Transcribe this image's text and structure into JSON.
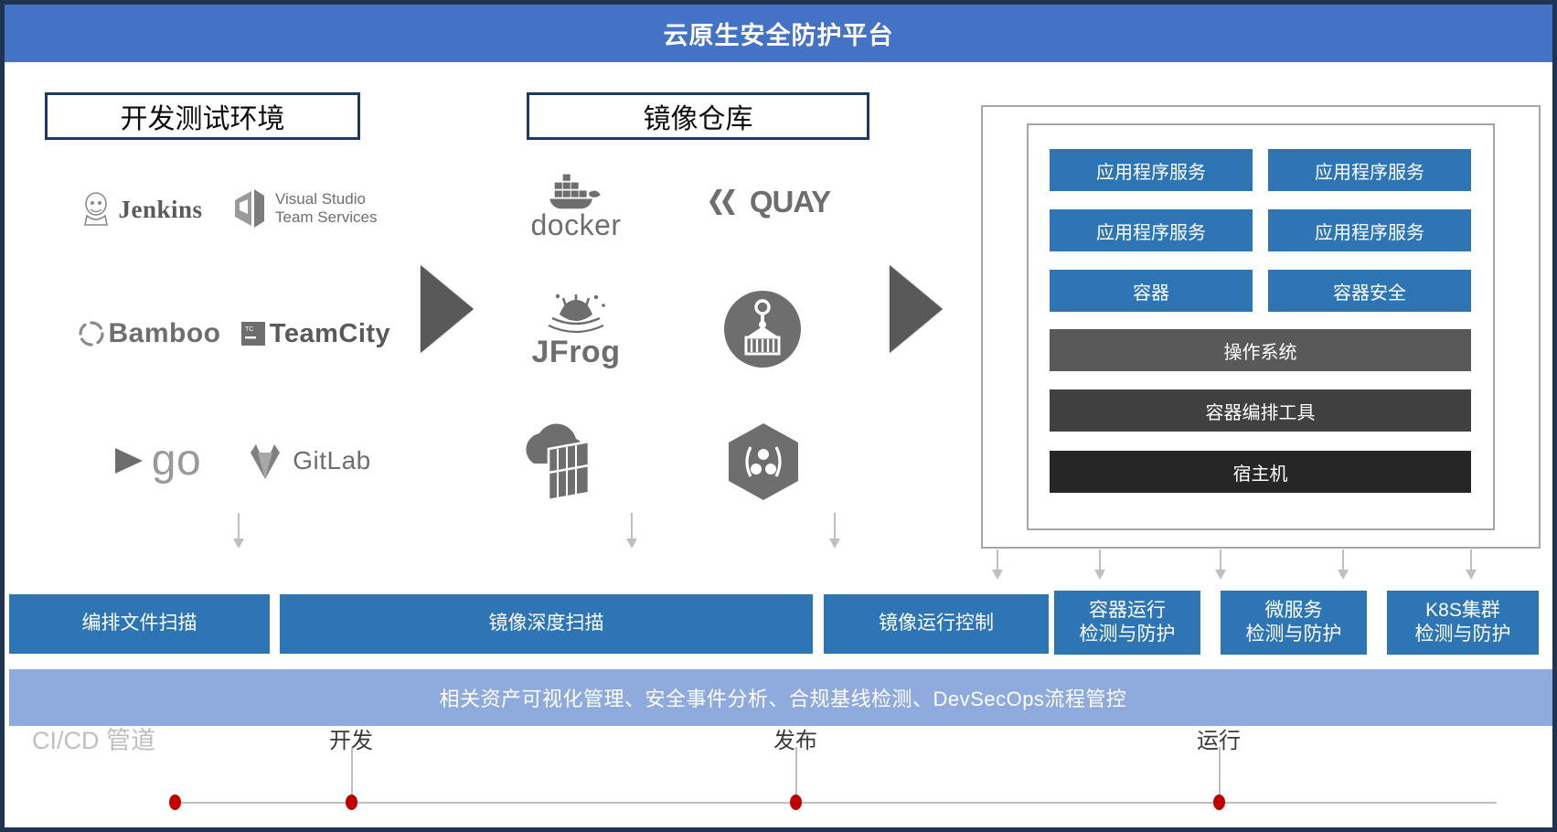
{
  "title": "云原生安全防护平台",
  "sections": {
    "dev": {
      "label": "开发测试环境"
    },
    "registry": {
      "label": "镜像仓库"
    }
  },
  "dev_logos": [
    {
      "name": "jenkins-logo",
      "label": "Jenkins"
    },
    {
      "name": "visual-studio-team-services-logo",
      "label": "Visual Studio\nTeam Services"
    },
    {
      "name": "bamboo-logo",
      "label": "Bamboo"
    },
    {
      "name": "teamcity-logo",
      "label": "TeamCity"
    },
    {
      "name": "gocd-logo",
      "label": "go"
    },
    {
      "name": "gitlab-logo",
      "label": "GitLab"
    }
  ],
  "registry_logos": [
    {
      "name": "docker-logo",
      "label": "docker"
    },
    {
      "name": "quay-logo",
      "label": "QUAY"
    },
    {
      "name": "jfrog-logo",
      "label": "JFrog"
    },
    {
      "name": "harbor-logo",
      "label": ""
    },
    {
      "name": "cloud-registry-logo",
      "label": ""
    },
    {
      "name": "nexus-logo",
      "label": ""
    }
  ],
  "stack": {
    "app_services": [
      "应用程序服务",
      "应用程序服务",
      "应用程序服务",
      "应用程序服务"
    ],
    "container": "容器",
    "container_security": "容器安全",
    "os": "操作系统",
    "orchestration": "容器编排工具",
    "host": "宿主机"
  },
  "capability_bars": [
    {
      "name": "orchestration-file-scan",
      "label": "编排文件扫描"
    },
    {
      "name": "image-deep-scan",
      "label": "镜像深度扫描"
    },
    {
      "name": "image-runtime-control",
      "label": "镜像运行控制"
    },
    {
      "name": "container-runtime-protection",
      "label": "容器运行\n检测与防护"
    },
    {
      "name": "microservice-protection",
      "label": "微服务\n检测与防护"
    },
    {
      "name": "k8s-cluster-protection",
      "label": "K8S集群\n检测与防护"
    }
  ],
  "governance_bar": "相关资产可视化管理、安全事件分析、合规基线检测、DevSecOps流程管控",
  "cicd": {
    "label": "CI/CD 管道",
    "stages": [
      "开发",
      "发布",
      "运行"
    ]
  },
  "colors": {
    "title_bar": "#4472C4",
    "frame_border": "#1F3352",
    "accent_blue": "#2E75B6",
    "governance_purple": "#8FAADC",
    "gray_os": "#595959",
    "gray_orchestration": "#404040",
    "gray_host": "#262626",
    "dot_red": "#C00000"
  }
}
